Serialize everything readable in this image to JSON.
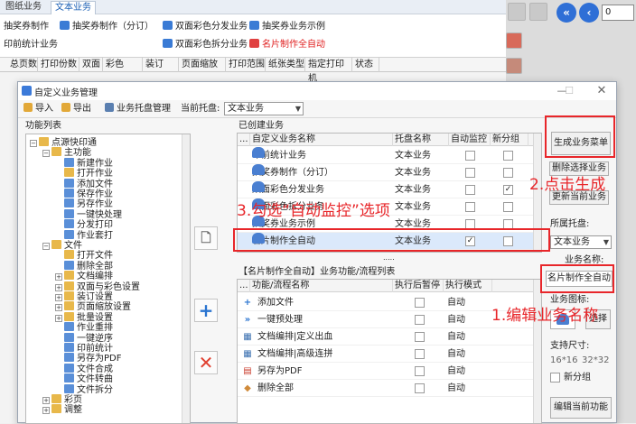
{
  "top_tabs": [
    "图纸业务",
    "文本业务"
  ],
  "ribbon": {
    "items": [
      {
        "label": "抽奖券制作",
        "color": ""
      },
      {
        "label": "抽奖券制作（分订）",
        "color": ""
      },
      {
        "label": "双面彩色分发业务",
        "color": ""
      },
      {
        "label": "抽奖券业务示例",
        "color": ""
      },
      {
        "label": "印前统计业务",
        "color": ""
      },
      {
        "label": "双面彩色拆分业务",
        "color": ""
      },
      {
        "label": "名片制作全自动",
        "color": "#e02020"
      }
    ]
  },
  "columns": [
    "总页数",
    "打印份数",
    "双面",
    "彩色",
    "装订",
    "页面缩放",
    "打印范围",
    "纸张类型",
    "指定打印机",
    "状态"
  ],
  "right_pane": {
    "page_value": "0"
  },
  "dialog": {
    "title": "自定义业务管理",
    "toolbar": {
      "import": "导入",
      "export": "导出",
      "tray_mgmt": "业务托盘管理",
      "current_tray_label": "当前托盘:",
      "current_tray_value": "文本业务"
    },
    "function_list_label": "功能列表",
    "tree": [
      {
        "label": "点源快印通",
        "level": 0,
        "exp": "−",
        "kind": "folder"
      },
      {
        "label": "主功能",
        "level": 1,
        "exp": "−",
        "kind": "folder"
      },
      {
        "label": "新建作业",
        "level": 2,
        "exp": "",
        "kind": "doc"
      },
      {
        "label": "打开作业",
        "level": 2,
        "exp": "",
        "kind": "folder"
      },
      {
        "label": "添加文件",
        "level": 2,
        "exp": "",
        "kind": "doc"
      },
      {
        "label": "保存作业",
        "level": 2,
        "exp": "",
        "kind": "doc"
      },
      {
        "label": "另存作业",
        "level": 2,
        "exp": "",
        "kind": "doc"
      },
      {
        "label": "一键快处理",
        "level": 2,
        "exp": "",
        "kind": "doc"
      },
      {
        "label": "分发打印",
        "level": 2,
        "exp": "",
        "kind": "doc"
      },
      {
        "label": "作业套打",
        "level": 2,
        "exp": "",
        "kind": "doc"
      },
      {
        "label": "文件",
        "level": 1,
        "exp": "−",
        "kind": "folder"
      },
      {
        "label": "打开文件",
        "level": 2,
        "exp": "",
        "kind": "folder"
      },
      {
        "label": "删除全部",
        "level": 2,
        "exp": "",
        "kind": "doc"
      },
      {
        "label": "文档编排",
        "level": 2,
        "exp": "+",
        "kind": "folder"
      },
      {
        "label": "双面与彩色设置",
        "level": 2,
        "exp": "+",
        "kind": "folder"
      },
      {
        "label": "装订设置",
        "level": 2,
        "exp": "+",
        "kind": "folder"
      },
      {
        "label": "页面缩放设置",
        "level": 2,
        "exp": "+",
        "kind": "folder"
      },
      {
        "label": "批量设置",
        "level": 2,
        "exp": "+",
        "kind": "folder"
      },
      {
        "label": "作业重排",
        "level": 2,
        "exp": "",
        "kind": "doc"
      },
      {
        "label": "一键逆序",
        "level": 2,
        "exp": "",
        "kind": "doc"
      },
      {
        "label": "印前统计",
        "level": 2,
        "exp": "",
        "kind": "doc"
      },
      {
        "label": "另存为PDF",
        "level": 2,
        "exp": "",
        "kind": "doc"
      },
      {
        "label": "文件合成",
        "level": 2,
        "exp": "",
        "kind": "doc"
      },
      {
        "label": "文件转曲",
        "level": 2,
        "exp": "",
        "kind": "doc"
      },
      {
        "label": "文件拆分",
        "level": 2,
        "exp": "",
        "kind": "doc"
      },
      {
        "label": "彩页",
        "level": 1,
        "exp": "+",
        "kind": "folder"
      },
      {
        "label": "调整",
        "level": 1,
        "exp": "+",
        "kind": "folder"
      }
    ],
    "created_label": "已创建业务",
    "created_headers": {
      "dots": "...",
      "name": "自定义业务名称",
      "tray": "托盘名称",
      "auto": "自动监控",
      "newgroup": "新分组"
    },
    "created_rows": [
      {
        "name": "印前统计业务",
        "tray": "文本业务",
        "auto": "",
        "newgroup": ""
      },
      {
        "name": "抽奖券制作（分订）",
        "tray": "文本业务",
        "auto": "",
        "newgroup": ""
      },
      {
        "name": "双面彩色分发业务",
        "tray": "文本业务",
        "auto": "",
        "newgroup": "✓"
      },
      {
        "name": "双面彩色拆分业务",
        "tray": "文本业务",
        "auto": "",
        "newgroup": ""
      },
      {
        "name": "抽奖券业务示例",
        "tray": "文本业务",
        "auto": "",
        "newgroup": ""
      },
      {
        "name": "名片制作全自动",
        "tray": "文本业务",
        "auto": "✓",
        "newgroup": ""
      }
    ],
    "more_dots": ".....",
    "flow_label": "【名片制作全自动】业务功能/流程列表",
    "flow_headers": {
      "dots": "...",
      "name": "功能/流程名称",
      "pause": "执行后暂停",
      "mode": "执行模式"
    },
    "flow_rows": [
      {
        "name": "添加文件",
        "mode": "自动"
      },
      {
        "name": "一键预处理",
        "mode": "自动"
      },
      {
        "name": "文档编排|定义出血",
        "mode": "自动"
      },
      {
        "name": "文档编排|高级连拼",
        "mode": "自动"
      },
      {
        "name": "另存为PDF",
        "mode": "自动"
      },
      {
        "name": "删除全部",
        "mode": "自动"
      }
    ],
    "right": {
      "gen_menu": "生成业务菜单",
      "del_selected": "删除选择业务",
      "update_current": "更新当前业务",
      "tray_label": "所属托盘:",
      "tray_value": "文本业务",
      "name_label": "业务名称:",
      "name_value": "名片制作全自动",
      "icon_label": "业务图标:",
      "choose": "选择",
      "size_label": "支持尺寸:",
      "size1": "16*16",
      "size2": "32*32",
      "newgroup": "新分组",
      "edit_func": "编辑当前功能"
    }
  },
  "annotations": {
    "a1": "1.编辑业务名称",
    "a2": "2.点击生成",
    "a3": "3.勾选“自动监控”选项"
  }
}
